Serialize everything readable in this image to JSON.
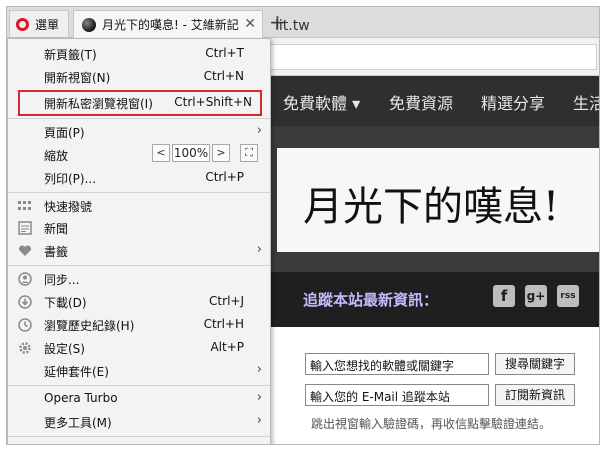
{
  "tabbar": {
    "menu_label": "選單",
    "tab_title": "月光下的嘆息! - 艾維新記",
    "close_glyph": "✕",
    "new_tab_glyph": "+"
  },
  "address": {
    "url_visible": "lit.tw"
  },
  "site": {
    "nav": [
      "免費軟體 ▾",
      "免費資源",
      "精選分享",
      "生活"
    ],
    "title": "月光下的嘆息!",
    "follow_text": "追蹤本站最新資訊：",
    "social": [
      "f",
      "g+",
      "rss"
    ],
    "search_value": "輸入您想找的軟體或關鍵字",
    "search_button": "搜尋關鍵字",
    "email_value": "輸入您的 E-Mail 追蹤本站",
    "subscribe_button": "訂閱新資訊",
    "helper_text": "跳出視窗輸入驗證碼，再收信點擊驗證連結。"
  },
  "menu": {
    "items": [
      {
        "label": "新頁籤(T)",
        "shortcut": "Ctrl+T"
      },
      {
        "label": "開新視窗(N)",
        "shortcut": "Ctrl+N"
      },
      {
        "label": "開新私密瀏覽視窗(I)",
        "shortcut": "Ctrl+Shift+N"
      },
      {
        "label": "頁面(P)",
        "shortcut": ""
      },
      {
        "label": "縮放",
        "shortcut": ""
      },
      {
        "label": "列印(P)...",
        "shortcut": "Ctrl+P"
      },
      {
        "label": "快速撥號",
        "shortcut": ""
      },
      {
        "label": "新聞",
        "shortcut": ""
      },
      {
        "label": "書籤",
        "shortcut": ""
      },
      {
        "label": "同步...",
        "shortcut": ""
      },
      {
        "label": "下載(D)",
        "shortcut": "Ctrl+J"
      },
      {
        "label": "瀏覽歷史紀錄(H)",
        "shortcut": "Ctrl+H"
      },
      {
        "label": "設定(S)",
        "shortcut": "Alt+P"
      },
      {
        "label": "延伸套件(E)",
        "shortcut": ""
      },
      {
        "label": "Opera Turbo",
        "shortcut": ""
      },
      {
        "label": "更多工具(M)",
        "shortcut": ""
      }
    ],
    "zoom": {
      "value": "100%",
      "minus": "<",
      "plus": ">",
      "fullscreen": "⛶"
    },
    "arrow": "›"
  },
  "colors": {
    "highlight": "#d9262f",
    "opera_red": "#e0132a"
  }
}
